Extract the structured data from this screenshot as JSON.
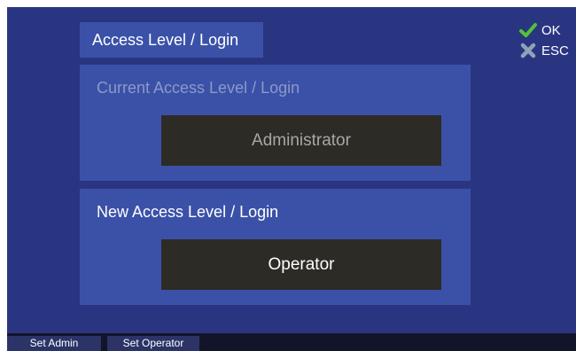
{
  "title": "Access Level / Login",
  "current": {
    "label": "Current Access Level / Login",
    "value": "Administrator"
  },
  "new": {
    "label": "New Access Level / Login",
    "value": "Operator"
  },
  "actions": {
    "ok_label": "OK",
    "esc_label": "ESC",
    "ok_icon": "checkmark-icon",
    "esc_icon": "cross-icon"
  },
  "footer": {
    "set_admin_label": "Set Admin",
    "set_operator_label": "Set Operator"
  },
  "colors": {
    "background": "#2a3582",
    "panel": "#3b51a8",
    "value_box": "#2d2b25",
    "ok_icon": "#54c234",
    "esc_icon": "#8fa3b8",
    "footer": "#12142a",
    "softkey": "#2b3367"
  }
}
